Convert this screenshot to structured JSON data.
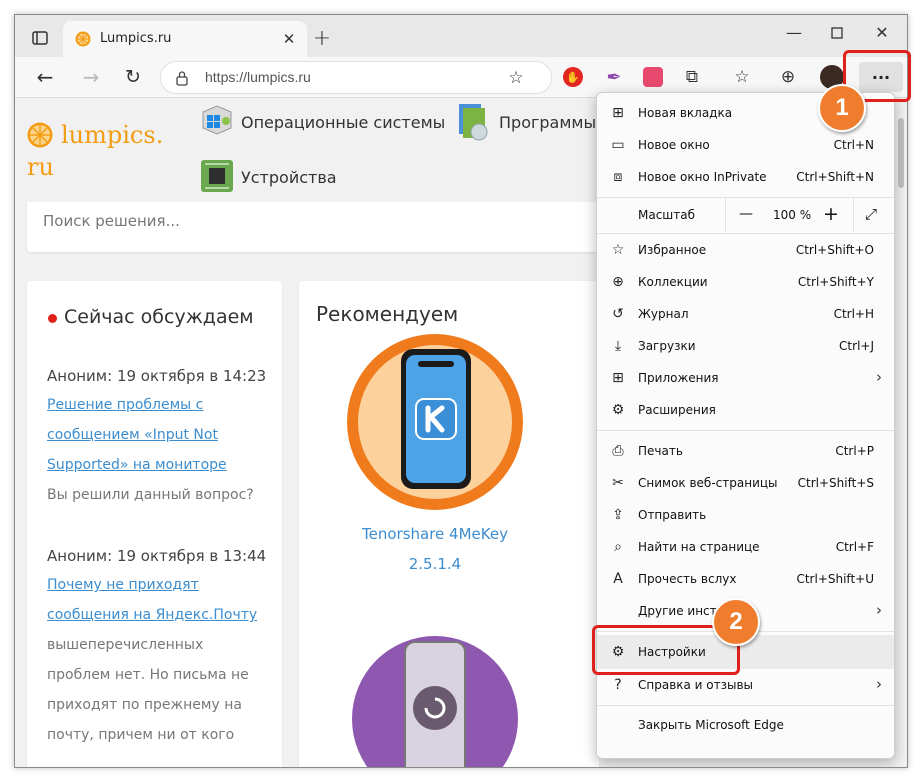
{
  "browser": {
    "tab_title": "Lumpics.ru",
    "url": "https://lumpics.ru",
    "menu_button": "···"
  },
  "site": {
    "logo_line1": "lumpics.",
    "logo_line2": "ru",
    "nav": [
      "Операционные системы",
      "Программы",
      "Устройства"
    ],
    "search_placeholder": "Поиск решения...",
    "discuss_title": "Сейчас обсуждаем",
    "discussions": [
      {
        "author": "Аноним: 19 октября в 14:23",
        "link_lines": [
          "Решение проблемы с",
          "сообщением «Input Not",
          "Supported» на мониторе"
        ],
        "text_lines": [
          "Вы решили данный вопрос?"
        ]
      },
      {
        "author": "Аноним: 19 октября в 13:44",
        "link_lines": [
          "Почему не приходят",
          "сообщения на Яндекс.Почту"
        ],
        "text_lines": [
          "вышеперечисленных",
          "проблем нет. Но письма не",
          "приходят по прежнему на",
          "почту, причем ни от кого"
        ]
      }
    ],
    "recommend_title": "Рекомендуем",
    "product_name": "Tenorshare 4MeKey",
    "product_version": "2.5.1.4"
  },
  "menu": {
    "items": [
      {
        "label": "Новая вкладка",
        "shortcut": ""
      },
      {
        "label": "Новое окно",
        "shortcut": "Ctrl+N"
      },
      {
        "label": "Новое окно InPrivate",
        "shortcut": "Ctrl+Shift+N"
      },
      {
        "label": "Избранное",
        "shortcut": "Ctrl+Shift+O"
      },
      {
        "label": "Коллекции",
        "shortcut": "Ctrl+Shift+Y"
      },
      {
        "label": "Журнал",
        "shortcut": "Ctrl+H"
      },
      {
        "label": "Загрузки",
        "shortcut": "Ctrl+J"
      },
      {
        "label": "Приложения",
        "shortcut": ""
      },
      {
        "label": "Расширения",
        "shortcut": ""
      },
      {
        "label": "Печать",
        "shortcut": "Ctrl+P"
      },
      {
        "label": "Снимок веб-страницы",
        "shortcut": "Ctrl+Shift+S"
      },
      {
        "label": "Отправить",
        "shortcut": ""
      },
      {
        "label": "Найти на странице",
        "shortcut": "Ctrl+F"
      },
      {
        "label": "Прочесть вслух",
        "shortcut": "Ctrl+Shift+U"
      },
      {
        "label": "Другие инстру",
        "shortcut": ""
      },
      {
        "label": "Настройки",
        "shortcut": ""
      },
      {
        "label": "Справка и отзывы",
        "shortcut": ""
      },
      {
        "label": "Закрыть Microsoft Edge",
        "shortcut": ""
      }
    ],
    "zoom_label": "Масштаб",
    "zoom_minus": "—",
    "zoom_value": "100 %",
    "zoom_plus": "+"
  },
  "annotations": {
    "badge1": "1",
    "badge2": "2"
  },
  "colors": {
    "accent_orange": "#ef7d2d",
    "highlight_red": "#e0201a",
    "link_blue": "#3c8dcf",
    "logo_orange": "#f39c12"
  }
}
